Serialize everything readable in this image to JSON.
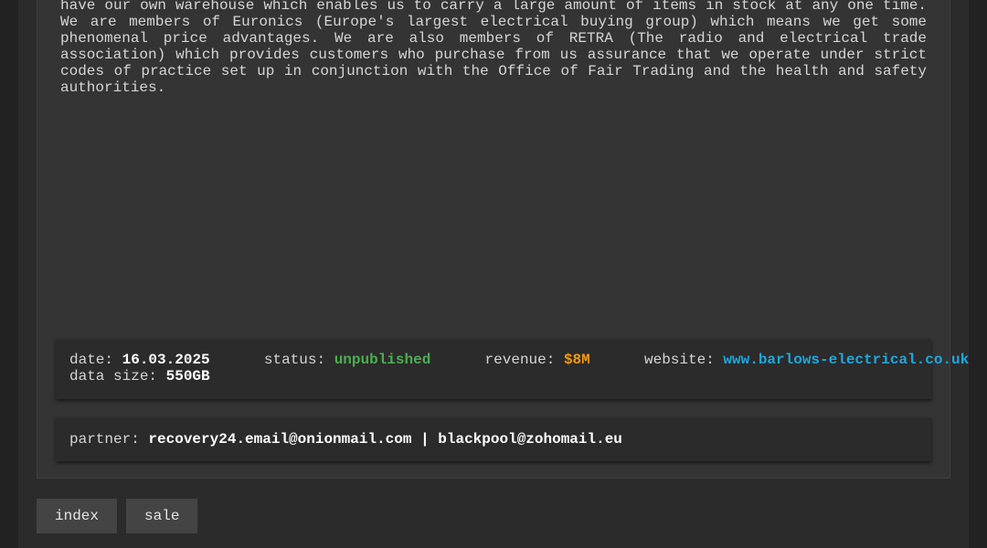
{
  "description": "have a delivery and installation team who are dedicated to getting your product to your home. We have our own warehouse which enables us to carry a large amount of items in stock at any one time. We are members of Euronics (Europe's largest electrical buying group) which means we get some phenomenal price advantages. We are also members of RETRA (The radio and electrical trade association) which provides customers who purchase from us assurance that we operate under strict codes of practice set up in conjunction with the Office of Fair Trading and the health and safety authorities.",
  "info": {
    "date_label": "date:",
    "date_value": "16.03.2025",
    "status_label": "status:",
    "status_value": "unpublished",
    "revenue_label": "revenue:",
    "revenue_value": "$8M",
    "website_label": "website:",
    "website_value": "www.barlows-electrical.co.uk",
    "data_size_label": "data size:",
    "data_size_value": "550GB"
  },
  "partner": {
    "label": "partner:",
    "value": "recovery24.email@onionmail.com | blackpool@zohomail.eu"
  },
  "nav": {
    "index_label": "index",
    "sale_label": "sale"
  },
  "colors": {
    "status": "#4caf50",
    "revenue": "#f39c12",
    "website": "#1ea7e0"
  }
}
